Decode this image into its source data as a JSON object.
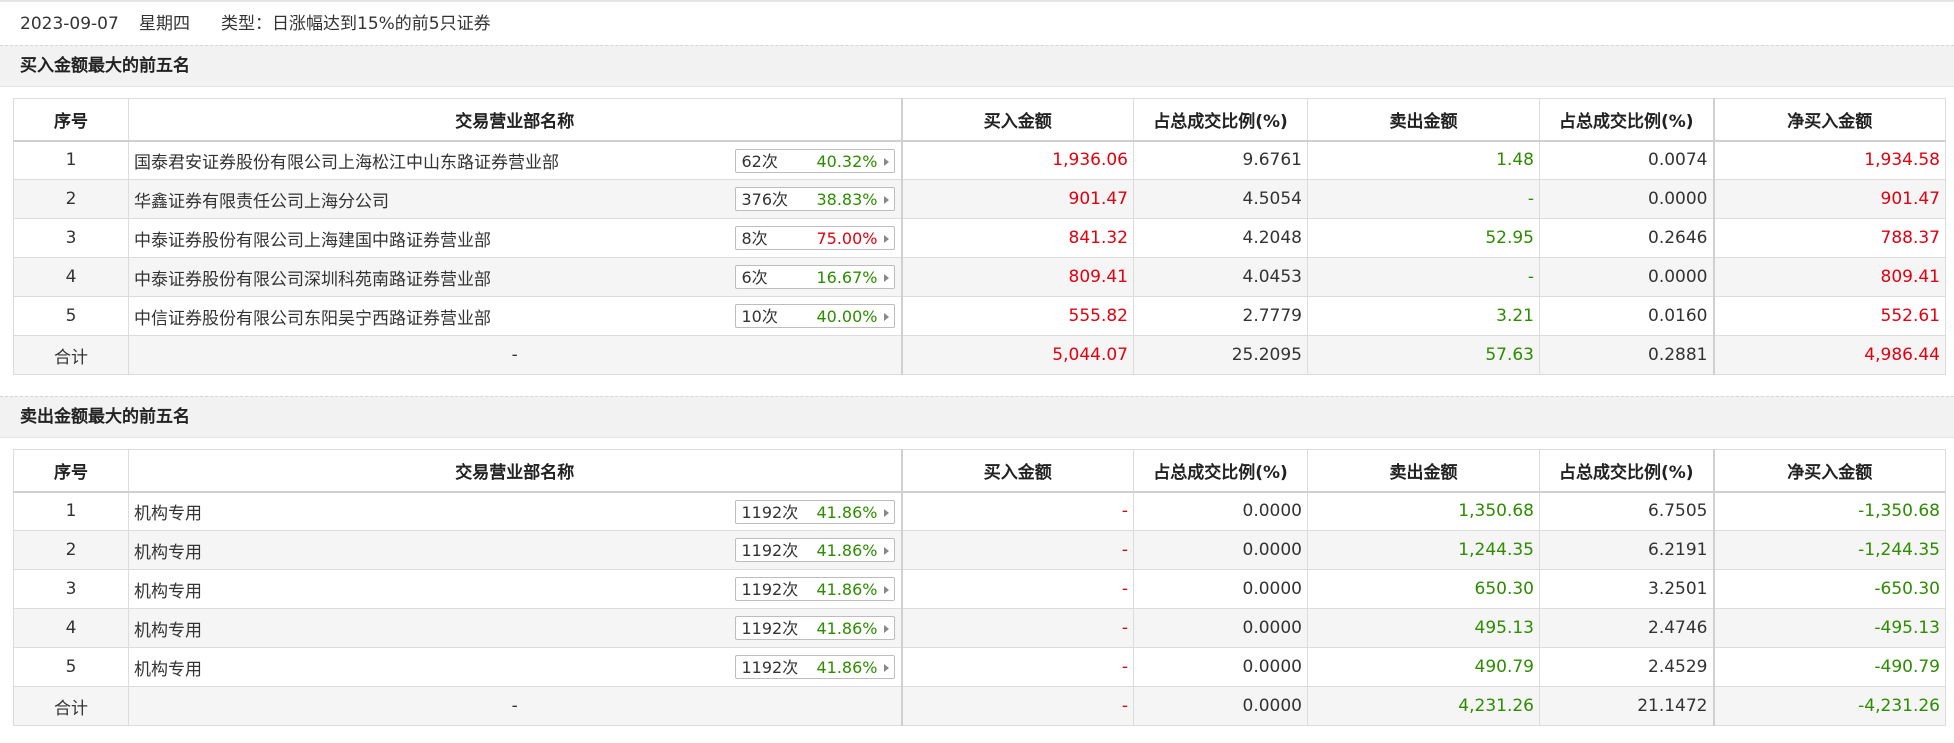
{
  "info": {
    "date": "2023-09-07",
    "weekday": "星期四",
    "type_label": "类型：日涨幅达到15%的前5只证券"
  },
  "colors": {
    "positive": "#e3000f",
    "negative": "#2d8c00"
  },
  "headers": [
    "序号",
    "交易营业部名称",
    "买入金额",
    "占总成交比例(%)",
    "卖出金额",
    "占总成交比例(%)",
    "净买入金额"
  ],
  "buy_section": {
    "title": "买入金额最大的前五名",
    "rows": [
      {
        "no": "1",
        "name": "国泰君安证券股份有限公司上海松江中山东路证券营业部",
        "count": "62次",
        "pct": "40.32%",
        "pct_color": "green",
        "buy": "1,936.06",
        "buy_ratio": "9.6761",
        "sell": "1.48",
        "sell_ratio": "0.0074",
        "net": "1,934.58",
        "net_color": "red"
      },
      {
        "no": "2",
        "name": "华鑫证券有限责任公司上海分公司",
        "count": "376次",
        "pct": "38.83%",
        "pct_color": "green",
        "buy": "901.47",
        "buy_ratio": "4.5054",
        "sell": "-",
        "sell_ratio": "0.0000",
        "net": "901.47",
        "net_color": "red"
      },
      {
        "no": "3",
        "name": "中泰证券股份有限公司上海建国中路证券营业部",
        "count": "8次",
        "pct": "75.00%",
        "pct_color": "red",
        "buy": "841.32",
        "buy_ratio": "4.2048",
        "sell": "52.95",
        "sell_ratio": "0.2646",
        "net": "788.37",
        "net_color": "red"
      },
      {
        "no": "4",
        "name": "中泰证券股份有限公司深圳科苑南路证券营业部",
        "count": "6次",
        "pct": "16.67%",
        "pct_color": "green",
        "buy": "809.41",
        "buy_ratio": "4.0453",
        "sell": "-",
        "sell_ratio": "0.0000",
        "net": "809.41",
        "net_color": "red"
      },
      {
        "no": "5",
        "name": "中信证券股份有限公司东阳吴宁西路证券营业部",
        "count": "10次",
        "pct": "40.00%",
        "pct_color": "green",
        "buy": "555.82",
        "buy_ratio": "2.7779",
        "sell": "3.21",
        "sell_ratio": "0.0160",
        "net": "552.61",
        "net_color": "red"
      }
    ],
    "total": {
      "label": "合计",
      "name": "-",
      "buy": "5,044.07",
      "buy_ratio": "25.2095",
      "sell": "57.63",
      "sell_ratio": "0.2881",
      "net": "4,986.44",
      "net_color": "red"
    }
  },
  "sell_section": {
    "title": "卖出金额最大的前五名",
    "rows": [
      {
        "no": "1",
        "name": "机构专用",
        "count": "1192次",
        "pct": "41.86%",
        "pct_color": "green",
        "buy": "-",
        "buy_ratio": "0.0000",
        "sell": "1,350.68",
        "sell_ratio": "6.7505",
        "net": "-1,350.68",
        "net_color": "green"
      },
      {
        "no": "2",
        "name": "机构专用",
        "count": "1192次",
        "pct": "41.86%",
        "pct_color": "green",
        "buy": "-",
        "buy_ratio": "0.0000",
        "sell": "1,244.35",
        "sell_ratio": "6.2191",
        "net": "-1,244.35",
        "net_color": "green"
      },
      {
        "no": "3",
        "name": "机构专用",
        "count": "1192次",
        "pct": "41.86%",
        "pct_color": "green",
        "buy": "-",
        "buy_ratio": "0.0000",
        "sell": "650.30",
        "sell_ratio": "3.2501",
        "net": "-650.30",
        "net_color": "green"
      },
      {
        "no": "4",
        "name": "机构专用",
        "count": "1192次",
        "pct": "41.86%",
        "pct_color": "green",
        "buy": "-",
        "buy_ratio": "0.0000",
        "sell": "495.13",
        "sell_ratio": "2.4746",
        "net": "-495.13",
        "net_color": "green"
      },
      {
        "no": "5",
        "name": "机构专用",
        "count": "1192次",
        "pct": "41.86%",
        "pct_color": "green",
        "buy": "-",
        "buy_ratio": "0.0000",
        "sell": "490.79",
        "sell_ratio": "2.4529",
        "net": "-490.79",
        "net_color": "green"
      }
    ],
    "total": {
      "label": "合计",
      "name": "-",
      "buy": "-",
      "buy_ratio": "0.0000",
      "sell": "4,231.26",
      "sell_ratio": "21.1472",
      "net": "-4,231.26",
      "net_color": "green"
    }
  }
}
